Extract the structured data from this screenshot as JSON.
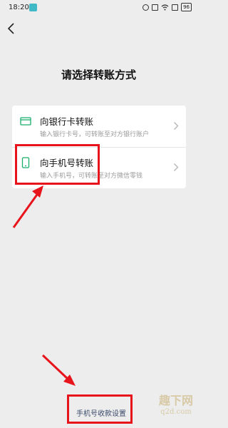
{
  "status_bar": {
    "time": "18:20",
    "battery": "96",
    "icons": [
      "alarm-icon",
      "vibrate-icon",
      "wifi-icon",
      "sim-icon"
    ]
  },
  "page": {
    "title": "请选择转账方式",
    "back_icon": "back-arrow-icon"
  },
  "options": [
    {
      "icon": "bank-card-icon",
      "title": "向银行卡转账",
      "subtitle": "输入银行卡号，可转账至对方银行账户"
    },
    {
      "icon": "phone-icon",
      "title": "向手机号转账",
      "subtitle": "输入手机号，可转账至对方微信零钱"
    }
  ],
  "footer": {
    "link_label": "手机号收款设置"
  },
  "watermark": {
    "line1": "趣下网",
    "line2": "q2d.com"
  },
  "colors": {
    "accent_green": "#1aad6c",
    "annotation_red": "#e8141b",
    "link_blue": "#3b4a6b"
  }
}
